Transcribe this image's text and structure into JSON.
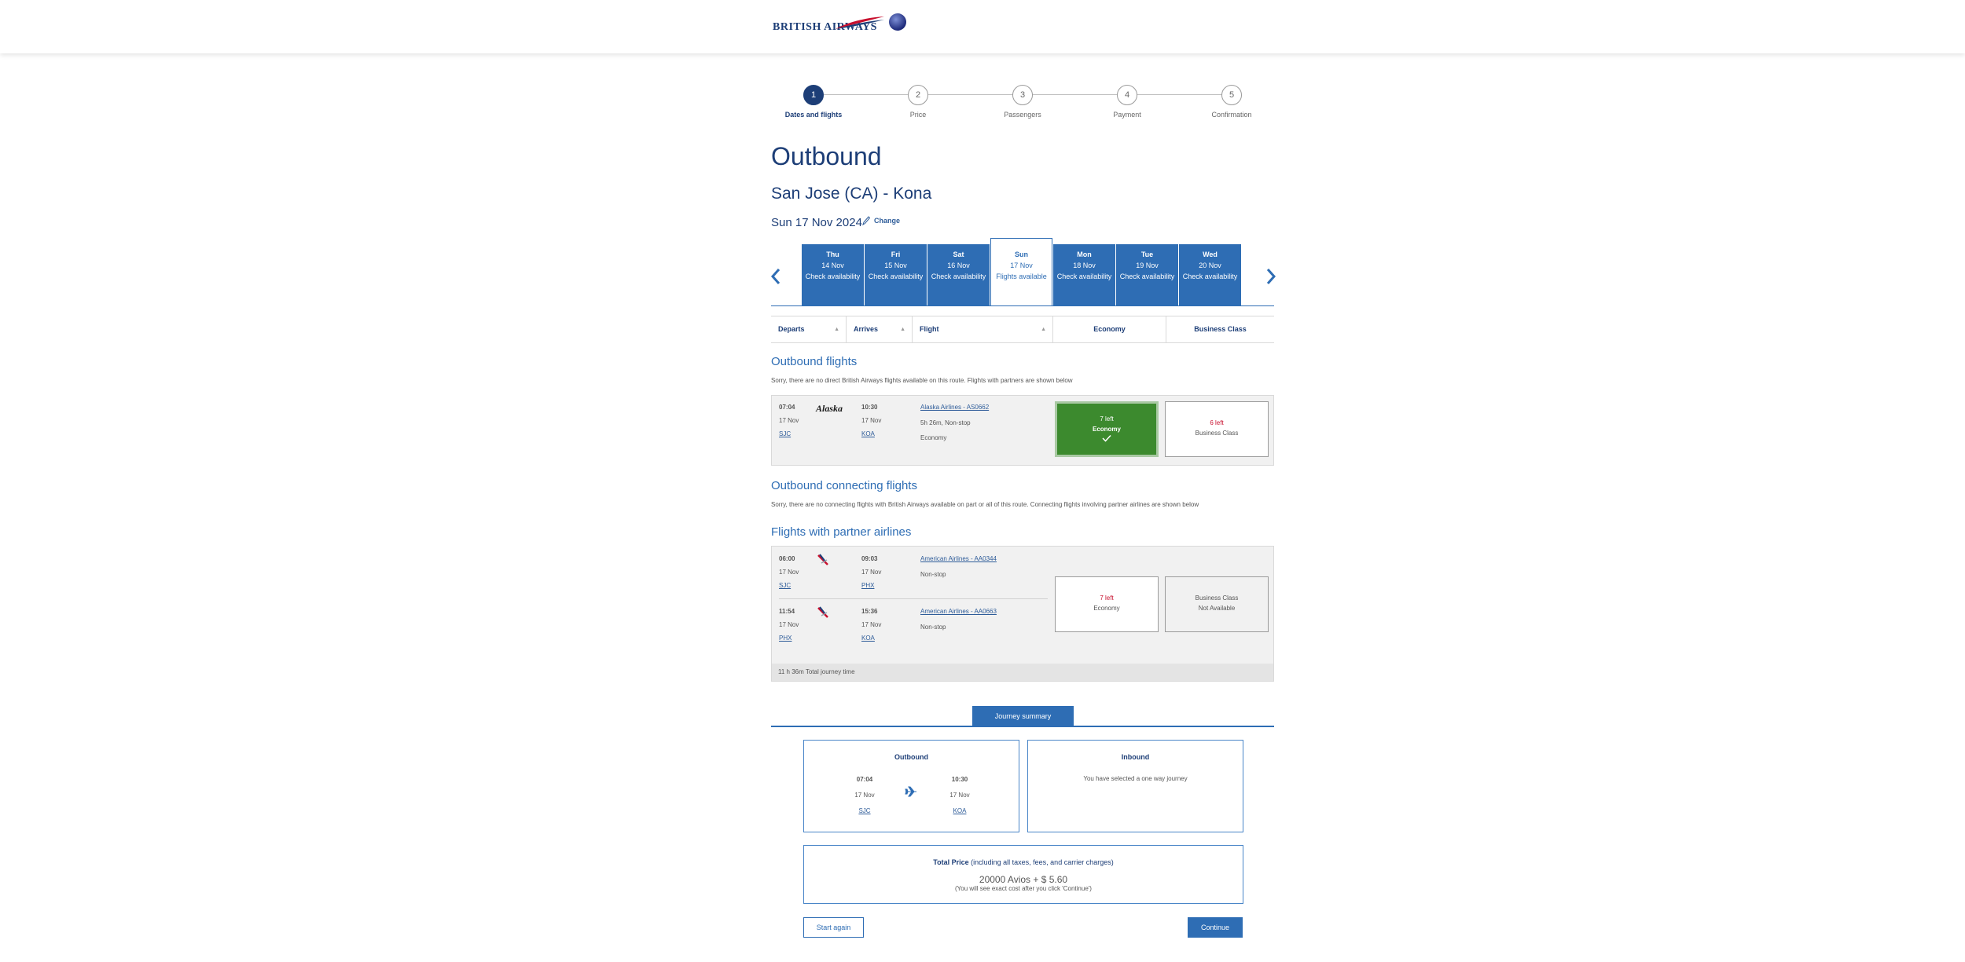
{
  "brand": {
    "name": "BRITISH AIRWAYS"
  },
  "stepper": [
    {
      "num": "1",
      "label": "Dates and flights"
    },
    {
      "num": "2",
      "label": "Price"
    },
    {
      "num": "3",
      "label": "Passengers"
    },
    {
      "num": "4",
      "label": "Payment"
    },
    {
      "num": "5",
      "label": "Confirmation"
    }
  ],
  "page": {
    "title": "Outbound",
    "route": "San Jose (CA) - Kona",
    "date": "Sun 17 Nov 2024",
    "change_label": "Change"
  },
  "dates": [
    {
      "day": "Thu",
      "date": "14 Nov",
      "status": "Check availability"
    },
    {
      "day": "Fri",
      "date": "15 Nov",
      "status": "Check availability"
    },
    {
      "day": "Sat",
      "date": "16 Nov",
      "status": "Check availability"
    },
    {
      "day": "Sun",
      "date": "17 Nov",
      "status": "Flights available"
    },
    {
      "day": "Mon",
      "date": "18 Nov",
      "status": "Check availability"
    },
    {
      "day": "Tue",
      "date": "19 Nov",
      "status": "Check availability"
    },
    {
      "day": "Wed",
      "date": "20 Nov",
      "status": "Check availability"
    }
  ],
  "table_header": {
    "departs": "Departs",
    "arrives": "Arrives",
    "flight": "Flight",
    "economy": "Economy",
    "business": "Business Class"
  },
  "direct": {
    "title": "Outbound flights",
    "note": "Sorry, there are no direct British Airways flights available on this route. Flights with partners are shown below",
    "flight": {
      "dep_time": "07:04",
      "dep_date": "17 Nov",
      "dep_code": "SJC",
      "airline_logo_text": "Alaska",
      "arr_time": "10:30",
      "arr_date": "17 Nov",
      "arr_code": "KOA",
      "flight_link": "Alaska Airlines - AS0662",
      "duration": "5h 26m, Non-stop",
      "cabin": "Economy",
      "economy_left": "7 left",
      "economy_label": "Economy",
      "business_left": "6 left",
      "business_label": "Business Class"
    }
  },
  "connecting": {
    "title": "Outbound connecting flights",
    "note": "Sorry, there are no connecting flights with British Airways available on part or all of this route. Connecting flights involving partner airlines are shown below"
  },
  "partner": {
    "title": "Flights with partner airlines",
    "legs": [
      {
        "dep_time": "06:00",
        "dep_date": "17 Nov",
        "dep_code": "SJC",
        "arr_time": "09:03",
        "arr_date": "17 Nov",
        "arr_code": "PHX",
        "flight_link": "American Airlines - AA0344",
        "stops": "Non-stop"
      },
      {
        "dep_time": "11:54",
        "dep_date": "17 Nov",
        "dep_code": "PHX",
        "arr_time": "15:36",
        "arr_date": "17 Nov",
        "arr_code": "KOA",
        "flight_link": "American Airlines - AA0663",
        "stops": "Non-stop"
      }
    ],
    "economy_left": "7 left",
    "economy_label": "Economy",
    "business_label": "Business Class",
    "business_status": "Not Available",
    "total_time": "11 h 36m Total journey time"
  },
  "summary": {
    "tab_label": "Journey summary",
    "outbound_title": "Outbound",
    "out_dep_time": "07:04",
    "out_dep_date": "17 Nov",
    "out_dep_code": "SJC",
    "out_arr_time": "10:30",
    "out_arr_date": "17 Nov",
    "out_arr_code": "KOA",
    "inbound_title": "Inbound",
    "inbound_note": "You have selected a one way journey",
    "price_label_bold": "Total Price",
    "price_label_rest": " (including all taxes, fees, and carrier charges)",
    "price_value": "20000 Avios + $ 5.60",
    "price_note": "(You will see exact cost after you click 'Continue')"
  },
  "buttons": {
    "start_again": "Start again",
    "continue": "Continue"
  },
  "colors": {
    "primary": "#2e6db4",
    "navy": "#1d3e77",
    "selected_fare": "#3c8a2e",
    "seats_warning": "#c8102e"
  }
}
